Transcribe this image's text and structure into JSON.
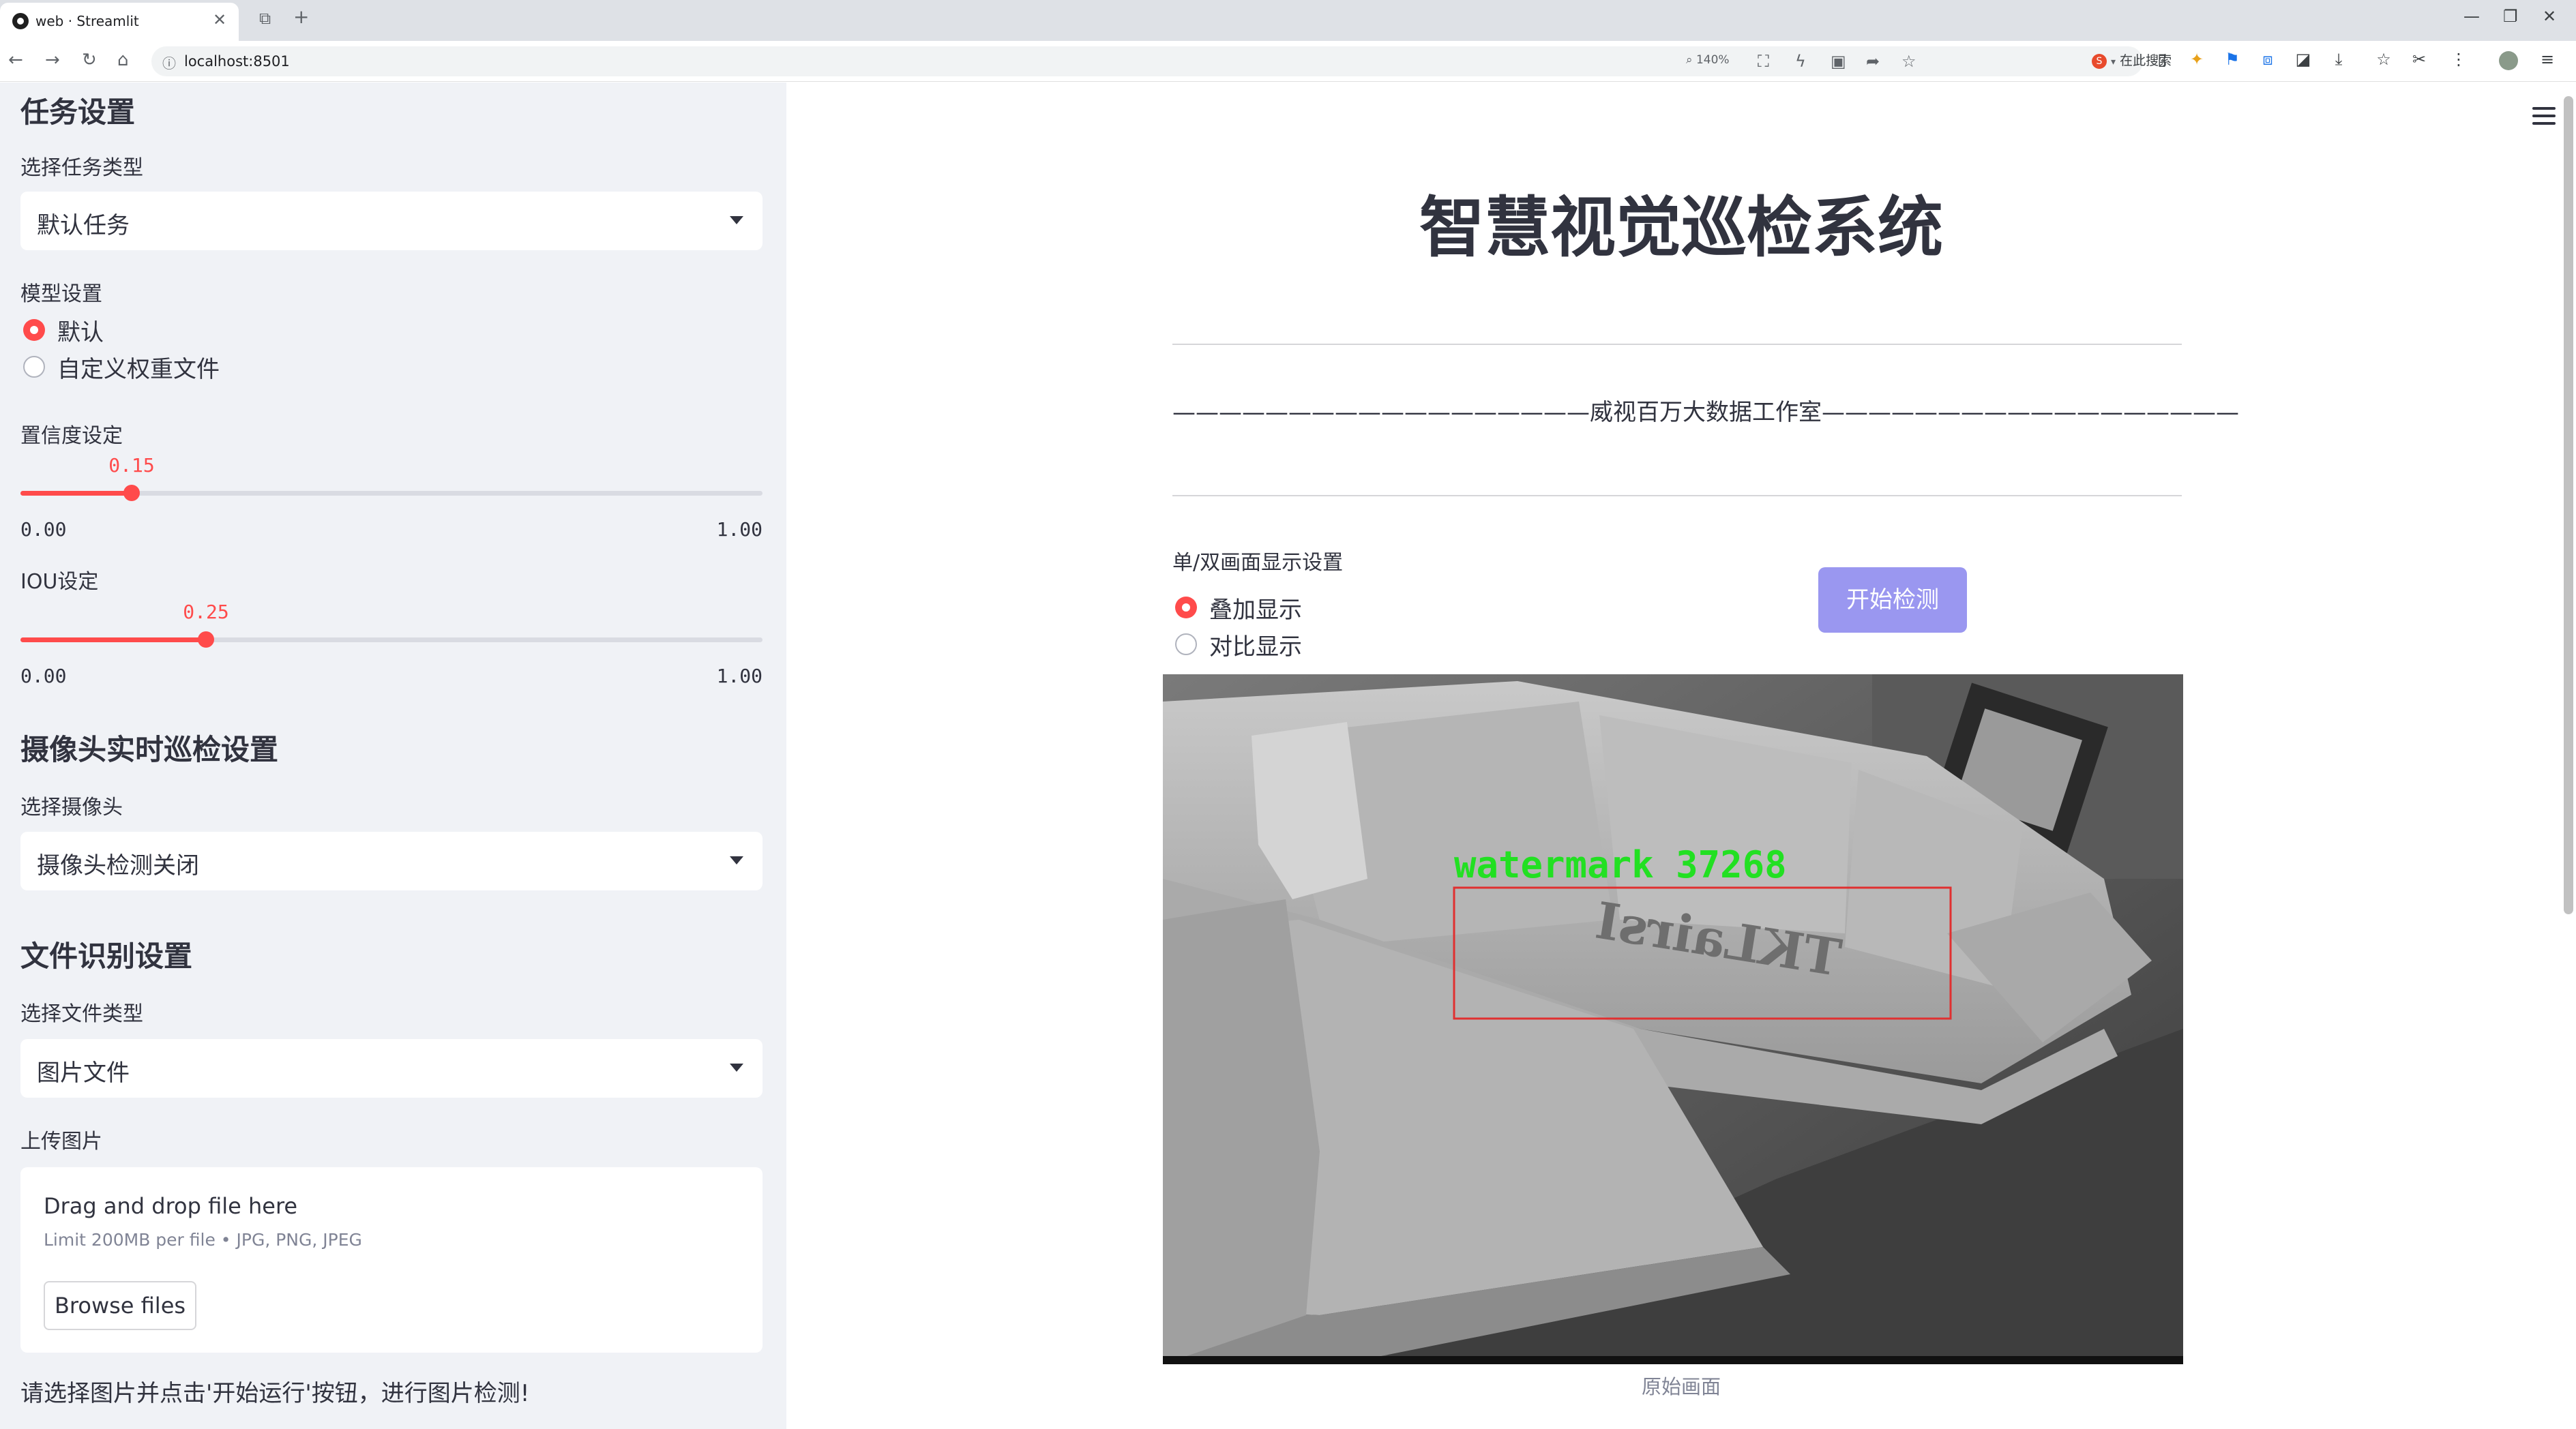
{
  "browser": {
    "tab_title": "web · Streamlit",
    "url": "localhost:8501",
    "zoom": "140%",
    "search_label": "在此搜索"
  },
  "sidebar": {
    "task_section": "任务设置",
    "task_type_label": "选择任务类型",
    "task_type_value": "默认任务",
    "model_label": "模型设置",
    "model_options": [
      "默认",
      "自定义权重文件"
    ],
    "model_selected": 0,
    "confidence_label": "置信度设定",
    "confidence": {
      "value": "0.15",
      "min": "0.00",
      "max": "1.00",
      "fraction": 0.15
    },
    "iou_label": "IOU设定",
    "iou": {
      "value": "0.25",
      "min": "0.00",
      "max": "1.00",
      "fraction": 0.25
    },
    "camera_section": "摄像头实时巡检设置",
    "camera_label": "选择摄像头",
    "camera_value": "摄像头检测关闭",
    "file_section": "文件识别设置",
    "file_type_label": "选择文件类型",
    "file_type_value": "图片文件",
    "upload_label": "上传图片",
    "uploader": {
      "drag_text": "Drag and drop file here",
      "limit_text": "Limit 200MB per file • JPG, PNG, JPEG",
      "browse_label": "Browse files"
    },
    "footer_text": "请选择图片并点击'开始运行'按钮，进行图片检测!"
  },
  "main": {
    "title": "智慧视觉巡检系统",
    "studio_line": "——————————————————威视百万大数据工作室——————————————————",
    "display_label": "单/双画面显示设置",
    "display_options": [
      "叠加显示",
      "对比显示"
    ],
    "display_selected": 0,
    "start_button": "开始检测",
    "detection_label": "watermark 37268",
    "watermark_text": "TKLairsI",
    "caption": "原始画面"
  },
  "colors": {
    "accent": "#ff4b4b",
    "button": "#9a97f0",
    "detection_box": "#e03030",
    "detection_label": "#22e022"
  }
}
